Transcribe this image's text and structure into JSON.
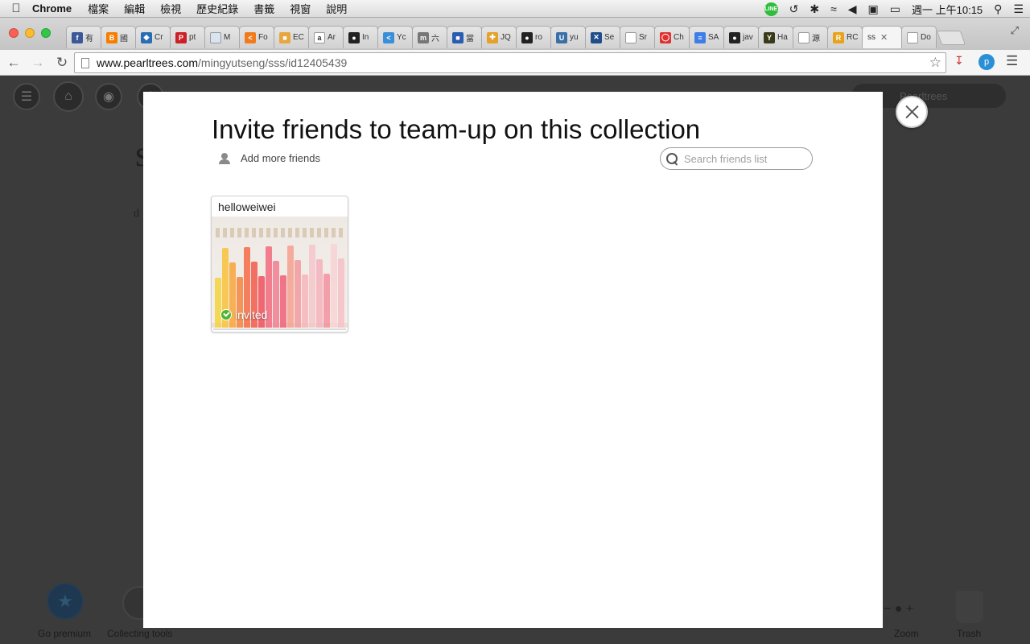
{
  "menubar": {
    "app_name": "Chrome",
    "items": [
      "檔案",
      "編輯",
      "檢視",
      "歷史紀錄",
      "書籤",
      "視窗",
      "說明"
    ],
    "clock": "週一 上午10:15"
  },
  "browser": {
    "tabs": [
      {
        "label": "有",
        "icon": "facebook-icon",
        "color": "#3b5998",
        "glyph": "f"
      },
      {
        "label": "國",
        "icon": "blogger-icon",
        "color": "#f57d00",
        "glyph": "B"
      },
      {
        "label": "Cr",
        "icon": "drop-icon",
        "color": "#2a6db5",
        "glyph": "◆"
      },
      {
        "label": "pt",
        "icon": "pinterest-icon",
        "color": "#cb2027",
        "glyph": "P"
      },
      {
        "label": "M",
        "icon": "circle-icon",
        "color": "#d8e4ef",
        "glyph": ""
      },
      {
        "label": "Fo",
        "icon": "code-icon",
        "color": "#f07b1d",
        "glyph": "<"
      },
      {
        "label": "EC",
        "icon": "box-icon",
        "color": "#e8a640",
        "glyph": "■"
      },
      {
        "label": "Ar",
        "icon": "amazon-icon",
        "color": "#ffffff",
        "glyph": "a"
      },
      {
        "label": "In",
        "icon": "github-icon",
        "color": "#222222",
        "glyph": "●"
      },
      {
        "label": "Yc",
        "icon": "chevron-icon",
        "color": "#3a8fd8",
        "glyph": "<"
      },
      {
        "label": "六",
        "icon": "m-icon",
        "color": "#777777",
        "glyph": "m"
      },
      {
        "label": "當",
        "icon": "folder-icon",
        "color": "#2a5db0",
        "glyph": "■"
      },
      {
        "label": "JQ",
        "icon": "puzzle-icon",
        "color": "#e4a12b",
        "glyph": "✚"
      },
      {
        "label": "ro",
        "icon": "github-icon",
        "color": "#222222",
        "glyph": "●"
      },
      {
        "label": "yu",
        "icon": "bucket-icon",
        "color": "#3a70a8",
        "glyph": "U"
      },
      {
        "label": "Se",
        "icon": "x-icon",
        "color": "#1f4e8a",
        "glyph": "✕"
      },
      {
        "label": "Sr",
        "icon": "page-icon",
        "color": "#ffffff",
        "glyph": ""
      },
      {
        "label": "Ch",
        "icon": "chat-icon",
        "color": "#e03131",
        "glyph": "◯"
      },
      {
        "label": "SA",
        "icon": "doc-icon",
        "color": "#3f7ee8",
        "glyph": "≡"
      },
      {
        "label": "jav",
        "icon": "github-icon",
        "color": "#222222",
        "glyph": "●"
      },
      {
        "label": "Ha",
        "icon": "y-icon",
        "color": "#3a3a1a",
        "glyph": "Y"
      },
      {
        "label": "源",
        "icon": "page-icon",
        "color": "#ffffff",
        "glyph": ""
      },
      {
        "label": "RC",
        "icon": "r-icon",
        "color": "#e8a319",
        "glyph": "R"
      },
      {
        "label": "ss",
        "icon": "",
        "color": "#f5f5f5",
        "glyph": "",
        "active": true
      },
      {
        "label": "Do",
        "icon": "page-icon",
        "color": "#ffffff",
        "glyph": ""
      }
    ],
    "url_host": "www.pearltrees.com",
    "url_path": "/mingyutseng/sss/id12405439"
  },
  "background": {
    "title_initial": "s",
    "subtitle_initial": "d",
    "search_placeholder": "Pearltrees",
    "go_premium": "Go premium",
    "collecting_tools": "Collecting tools",
    "zoom": "Zoom",
    "trash": "Trash"
  },
  "modal": {
    "title": "Invite friends to team-up on this collection",
    "add_friends_label": "Add more friends",
    "search_placeholder": "Search friends list",
    "friends": [
      {
        "name": "helloweiwei",
        "status": "invited"
      }
    ]
  }
}
